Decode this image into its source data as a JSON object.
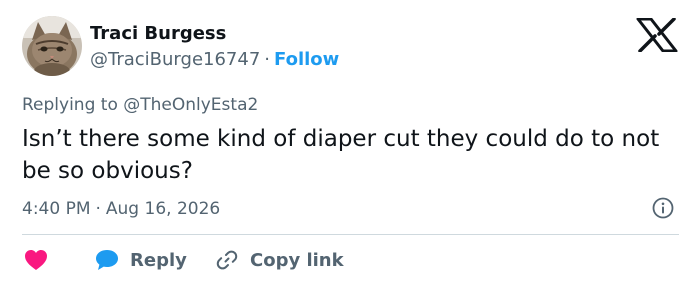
{
  "author": {
    "name": "Traci Burgess",
    "handle": "@TraciBurge16747",
    "separator": "·",
    "follow_label": "Follow",
    "avatar_icon": "cat-avatar"
  },
  "platform_icon": "x-logo-icon",
  "replying": {
    "prefix": "Replying to",
    "handle": "@TheOnlyEsta2"
  },
  "tweet": {
    "text": "Isn’t there some kind of diaper cut they could do to not be so obvious?"
  },
  "meta": {
    "time": "4:40 PM",
    "separator": "·",
    "date": "Aug 16, 2026"
  },
  "actions": {
    "like_icon": "heart-icon",
    "reply_label": "Reply",
    "reply_icon": "speech-bubble-icon",
    "copy_label": "Copy link",
    "copy_icon": "link-icon"
  },
  "colors": {
    "accent": "#1d9bf0",
    "like": "#f91880",
    "text": "#0f1419",
    "muted": "#536471",
    "divider": "#cfd9de"
  }
}
